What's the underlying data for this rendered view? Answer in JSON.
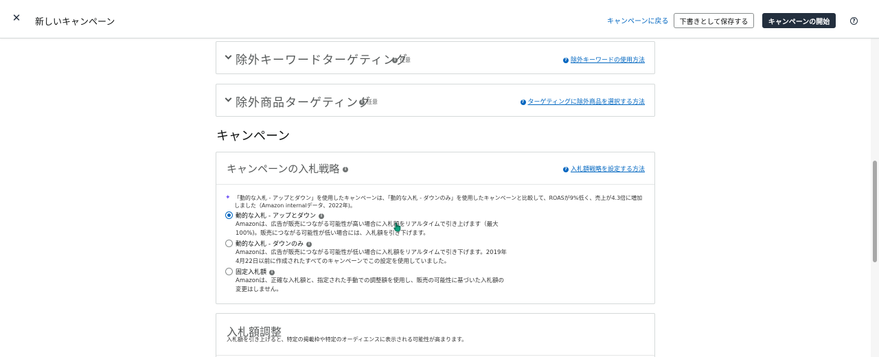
{
  "header": {
    "close_glyph": "✕",
    "title": "新しいキャンペーン",
    "back_link": "キャンペーンに戻る",
    "save_draft": "下書きとして保存する",
    "start_campaign": "キャンペーンの開始",
    "help_glyph": "?"
  },
  "negative_keyword_card": {
    "title": "除外キーワードターゲティング",
    "optional": "任意",
    "help_link": "除外キーワードの使用方法"
  },
  "negative_product_card": {
    "title": "除外商品ターゲティング",
    "optional": "任意",
    "help_link": "ターゲティングに除外商品を選択する方法"
  },
  "section_heading": "キャンペーン",
  "bid_strategy": {
    "title": "キャンペーンの入札戦略",
    "help_link": "入札額戦略を設定する方法",
    "note": "「動的な入札 - アップとダウン」を使用したキャンペーンは、「動的な入札 - ダウンのみ」を使用したキャンペーンと比較して、ROASが9%低く、売上が4.3倍に増加しました（Amazon internalデータ、2022年)。",
    "options": [
      {
        "label": "動的な入札 - アップとダウン",
        "desc": "Amazonは、広告が販売につながる可能性が高い場合に入札額をリアルタイムで引き上げます（最大100%)。販売につながる可能性が低い場合には、入札額を引き下げます。",
        "selected": true
      },
      {
        "label": "動的な入札 - ダウンのみ",
        "desc": "Amazonは、広告が販売につながる可能性が低い場合に入札額をリアルタイムで引き下げます。2019年4月22日以前に作成されたすべてのキャンペーンでこの設定を使用していました。",
        "selected": false
      },
      {
        "label": "固定入札額",
        "desc": "Amazonは、正確な入札額と、指定された手動での調整額を使用し、販売の可能性に基づいた入札額の変更はしません。",
        "selected": false
      }
    ]
  },
  "bid_adjustment": {
    "title": "入札額調整",
    "subtitle": "入札額を引き上げると、特定の掲載枠や特定のオーディエンスに表示される可能性が高まります。"
  },
  "colors": {
    "link": "#0066c0",
    "primary_button": "#232f3e",
    "sparkle": "#6b4ff6",
    "cursor": "#10a37f"
  }
}
